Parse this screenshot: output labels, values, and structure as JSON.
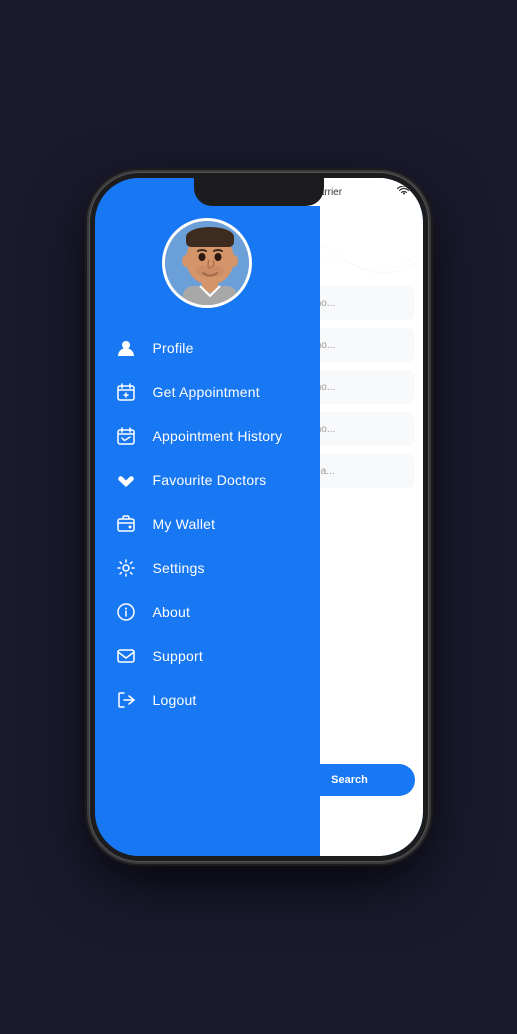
{
  "phone": {
    "status_bar": {
      "signal": "●●○○○",
      "carrier": "Carrier",
      "wifi": "wifi"
    }
  },
  "sidebar": {
    "menu_items": [
      {
        "id": "profile",
        "label": "Profile",
        "icon": "person"
      },
      {
        "id": "get-appointment",
        "label": "Get Appointment",
        "icon": "calendar-plus"
      },
      {
        "id": "appointment-history",
        "label": "Appointment History",
        "icon": "calendar-check"
      },
      {
        "id": "favourite-doctors",
        "label": "Favourite Doctors",
        "icon": "star"
      },
      {
        "id": "my-wallet",
        "label": "My Wallet",
        "icon": "wallet"
      },
      {
        "id": "settings",
        "label": "Settings",
        "icon": "gear"
      },
      {
        "id": "about",
        "label": "About",
        "icon": "info"
      },
      {
        "id": "support",
        "label": "Support",
        "icon": "envelope"
      },
      {
        "id": "logout",
        "label": "Logout",
        "icon": "door-open"
      }
    ]
  },
  "right_panel": {
    "filter_items": [
      {
        "id": "item1",
        "text": "Cho...",
        "icon": "location-pin"
      },
      {
        "id": "item2",
        "text": "Cho...",
        "icon": "location-pin"
      },
      {
        "id": "item3",
        "text": "Cho...",
        "icon": "location-pin"
      },
      {
        "id": "item4",
        "text": "Cho...",
        "icon": "person-heart"
      },
      {
        "id": "item5",
        "text": "Sea...",
        "icon": "search-person"
      }
    ],
    "button_label": "Search"
  },
  "icons": {
    "person": "👤",
    "calendar-plus": "📅",
    "calendar-check": "📆",
    "star": "⭐",
    "wallet": "👜",
    "gear": "⚙️",
    "info": "ℹ️",
    "envelope": "✉️",
    "door-open": "🚪"
  }
}
